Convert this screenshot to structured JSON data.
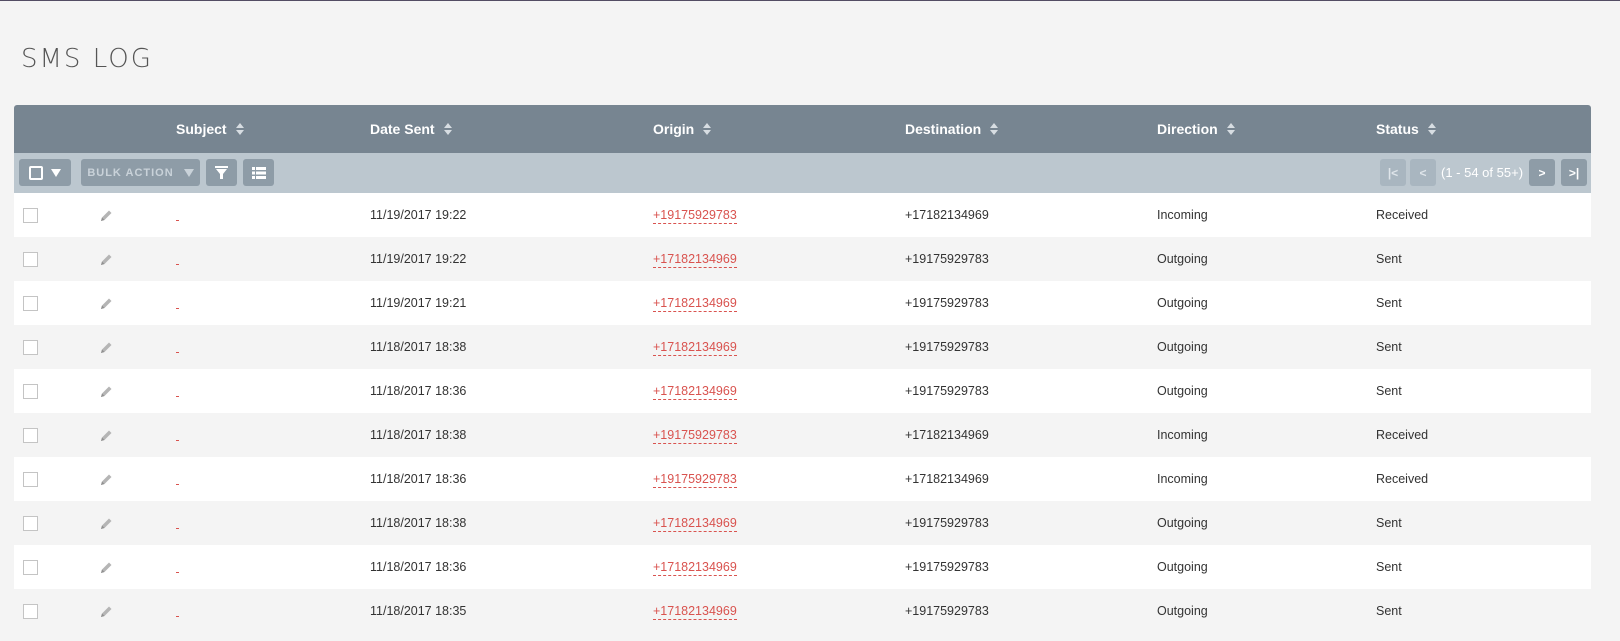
{
  "page": {
    "title": "SMS LOG"
  },
  "columns": [
    {
      "key": "subject",
      "label": "Subject"
    },
    {
      "key": "date_sent",
      "label": "Date Sent"
    },
    {
      "key": "origin",
      "label": "Origin"
    },
    {
      "key": "destination",
      "label": "Destination"
    },
    {
      "key": "direction",
      "label": "Direction"
    },
    {
      "key": "status",
      "label": "Status"
    }
  ],
  "toolbar": {
    "bulk_action": "BULK ACTION",
    "pagination": {
      "first": "|<",
      "prev": "<",
      "summary": "(1 - 54 of 55+)",
      "next": ">",
      "last": ">|"
    }
  },
  "icons": {
    "select": "checkbox-icon",
    "filter": "filter-icon",
    "columns": "column-chooser-icon",
    "edit": "pencil-icon",
    "sort": "sort-icon"
  },
  "colors": {
    "header_bg": "#778591",
    "toolbar_bg": "#bcc7cf",
    "link": "#d9534f"
  },
  "rows": [
    {
      "date_sent": "11/19/2017 19:22",
      "origin": "+19175929783",
      "destination": "+17182134969",
      "direction": "Incoming",
      "status": "Received"
    },
    {
      "date_sent": "11/19/2017 19:22",
      "origin": "+17182134969",
      "destination": "+19175929783",
      "direction": "Outgoing",
      "status": "Sent"
    },
    {
      "date_sent": "11/19/2017 19:21",
      "origin": "+17182134969",
      "destination": "+19175929783",
      "direction": "Outgoing",
      "status": "Sent"
    },
    {
      "date_sent": "11/18/2017 18:38",
      "origin": "+17182134969",
      "destination": "+19175929783",
      "direction": "Outgoing",
      "status": "Sent"
    },
    {
      "date_sent": "11/18/2017 18:36",
      "origin": "+17182134969",
      "destination": "+19175929783",
      "direction": "Outgoing",
      "status": "Sent"
    },
    {
      "date_sent": "11/18/2017 18:38",
      "origin": "+19175929783",
      "destination": "+17182134969",
      "direction": "Incoming",
      "status": "Received"
    },
    {
      "date_sent": "11/18/2017 18:36",
      "origin": "+19175929783",
      "destination": "+17182134969",
      "direction": "Incoming",
      "status": "Received"
    },
    {
      "date_sent": "11/18/2017 18:38",
      "origin": "+17182134969",
      "destination": "+19175929783",
      "direction": "Outgoing",
      "status": "Sent"
    },
    {
      "date_sent": "11/18/2017 18:36",
      "origin": "+17182134969",
      "destination": "+19175929783",
      "direction": "Outgoing",
      "status": "Sent"
    },
    {
      "date_sent": "11/18/2017 18:35",
      "origin": "+17182134969",
      "destination": "+19175929783",
      "direction": "Outgoing",
      "status": "Sent"
    }
  ]
}
